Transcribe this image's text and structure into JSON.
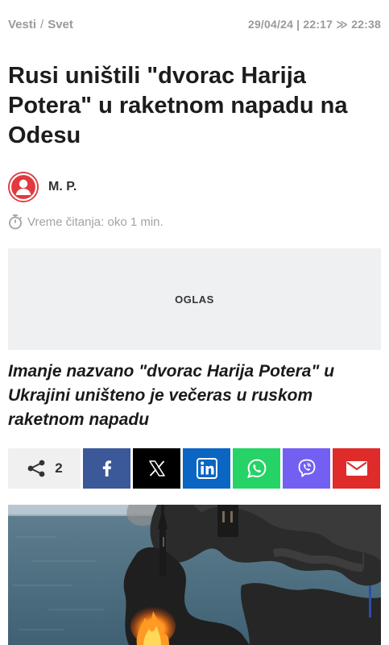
{
  "breadcrumb": {
    "section": "Vesti",
    "separator": "/",
    "subsection": "Svet"
  },
  "timestamp": "29/04/24 | 22:17 ≫ 22:38",
  "article": {
    "title": "Rusi uništili \"dvorac Harija Potera\" u raketnom napadu na Odesu",
    "author": "M. P.",
    "reading_time": "Vreme čitanja: oko 1 min.",
    "ad_label": "OGLAS",
    "lead": "Imanje nazvano \"dvorac Harija Potera\" u Ukrajini uništeno je večeras u ruskom raketnom napadu"
  },
  "share": {
    "count": "2",
    "buttons": [
      {
        "network": "facebook",
        "icon": "facebook-icon",
        "color": "#3b5998"
      },
      {
        "network": "x",
        "icon": "x-icon",
        "color": "#000000"
      },
      {
        "network": "linkedin",
        "icon": "linkedin-icon",
        "color": "#0a66c2"
      },
      {
        "network": "whatsapp",
        "icon": "whatsapp-icon",
        "color": "#25d366"
      },
      {
        "network": "viber",
        "icon": "viber-icon",
        "color": "#7360f2"
      },
      {
        "network": "email",
        "icon": "envelope-icon",
        "color": "#e02b2b"
      }
    ]
  },
  "colors": {
    "accent": "#e03a3e",
    "muted_text": "#9a9a9a",
    "ad_background": "#eef0f2"
  }
}
